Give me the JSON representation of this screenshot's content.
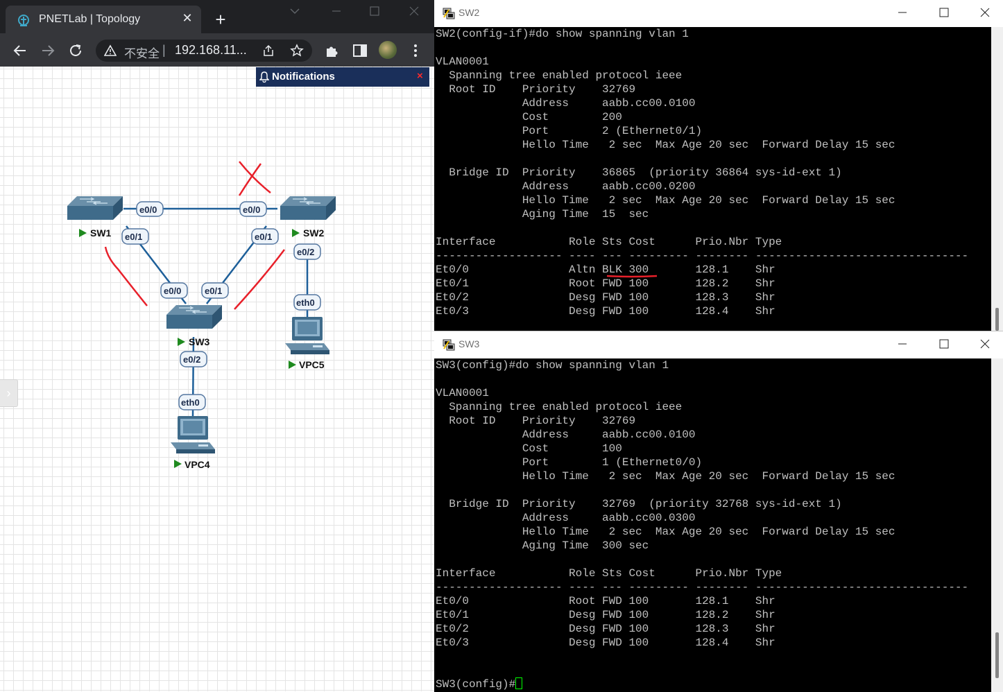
{
  "browser": {
    "tab_title": "PNETLab | Topology",
    "url_security": "不安全",
    "url_separator": "|",
    "url": "192.168.11..."
  },
  "notifications": {
    "title": "Notifications",
    "close": "×"
  },
  "topology": {
    "nodes": {
      "sw1": "SW1",
      "sw2": "SW2",
      "sw3": "SW3",
      "vpc4": "VPC4",
      "vpc5": "VPC5"
    },
    "ports": {
      "sw1_e00": "e0/0",
      "sw2_e00": "e0/0",
      "sw1_e01": "e0/1",
      "sw2_e01": "e0/1",
      "sw2_e02": "e0/2",
      "sw3_e00": "e0/0",
      "sw3_e01": "e0/1",
      "sw3_e02": "e0/2",
      "vpc4_eth0": "eth0",
      "vpc5_eth0": "eth0"
    },
    "annotation_color": "#e8202a",
    "link_color": "#1d5f99"
  },
  "sw2_terminal": {
    "title": "SW2",
    "lines": [
      "SW2(config-if)#do show spanning vlan 1",
      "",
      "VLAN0001",
      "  Spanning tree enabled protocol ieee",
      "  Root ID    Priority    32769",
      "             Address     aabb.cc00.0100",
      "             Cost        200",
      "             Port        2 (Ethernet0/1)",
      "             Hello Time   2 sec  Max Age 20 sec  Forward Delay 15 sec",
      "",
      "  Bridge ID  Priority    36865  (priority 36864 sys-id-ext 1)",
      "             Address     aabb.cc00.0200",
      "             Hello Time   2 sec  Max Age 20 sec  Forward Delay 15 sec",
      "             Aging Time  15  sec",
      "",
      "Interface           Role Sts Cost      Prio.Nbr Type",
      "------------------- ---- --- --------- -------- --------------------------------",
      "Et0/0               Altn BLK 300       128.1    Shr",
      "Et0/1               Root FWD 100       128.2    Shr",
      "Et0/2               Desg FWD 100       128.3    Shr",
      "Et0/3               Desg FWD 100       128.4    Shr"
    ]
  },
  "sw3_terminal": {
    "title": "SW3",
    "lines": [
      "SW3(config)#do show spanning vlan 1",
      "",
      "VLAN0001",
      "  Spanning tree enabled protocol ieee",
      "  Root ID    Priority    32769",
      "             Address     aabb.cc00.0100",
      "             Cost        100",
      "             Port        1 (Ethernet0/0)",
      "             Hello Time   2 sec  Max Age 20 sec  Forward Delay 15 sec",
      "",
      "  Bridge ID  Priority    32769  (priority 32768 sys-id-ext 1)",
      "             Address     aabb.cc00.0300",
      "             Hello Time   2 sec  Max Age 20 sec  Forward Delay 15 sec",
      "             Aging Time  300 sec",
      "",
      "Interface           Role Sts Cost      Prio.Nbr Type",
      "------------------- ---- --- --------- -------- --------------------------------",
      "Et0/0               Root FWD 100       128.1    Shr",
      "Et0/1               Desg FWD 100       128.2    Shr",
      "Et0/2               Desg FWD 100       128.3    Shr",
      "Et0/3               Desg FWD 100       128.4    Shr",
      "",
      "",
      "SW3(config)#"
    ]
  }
}
